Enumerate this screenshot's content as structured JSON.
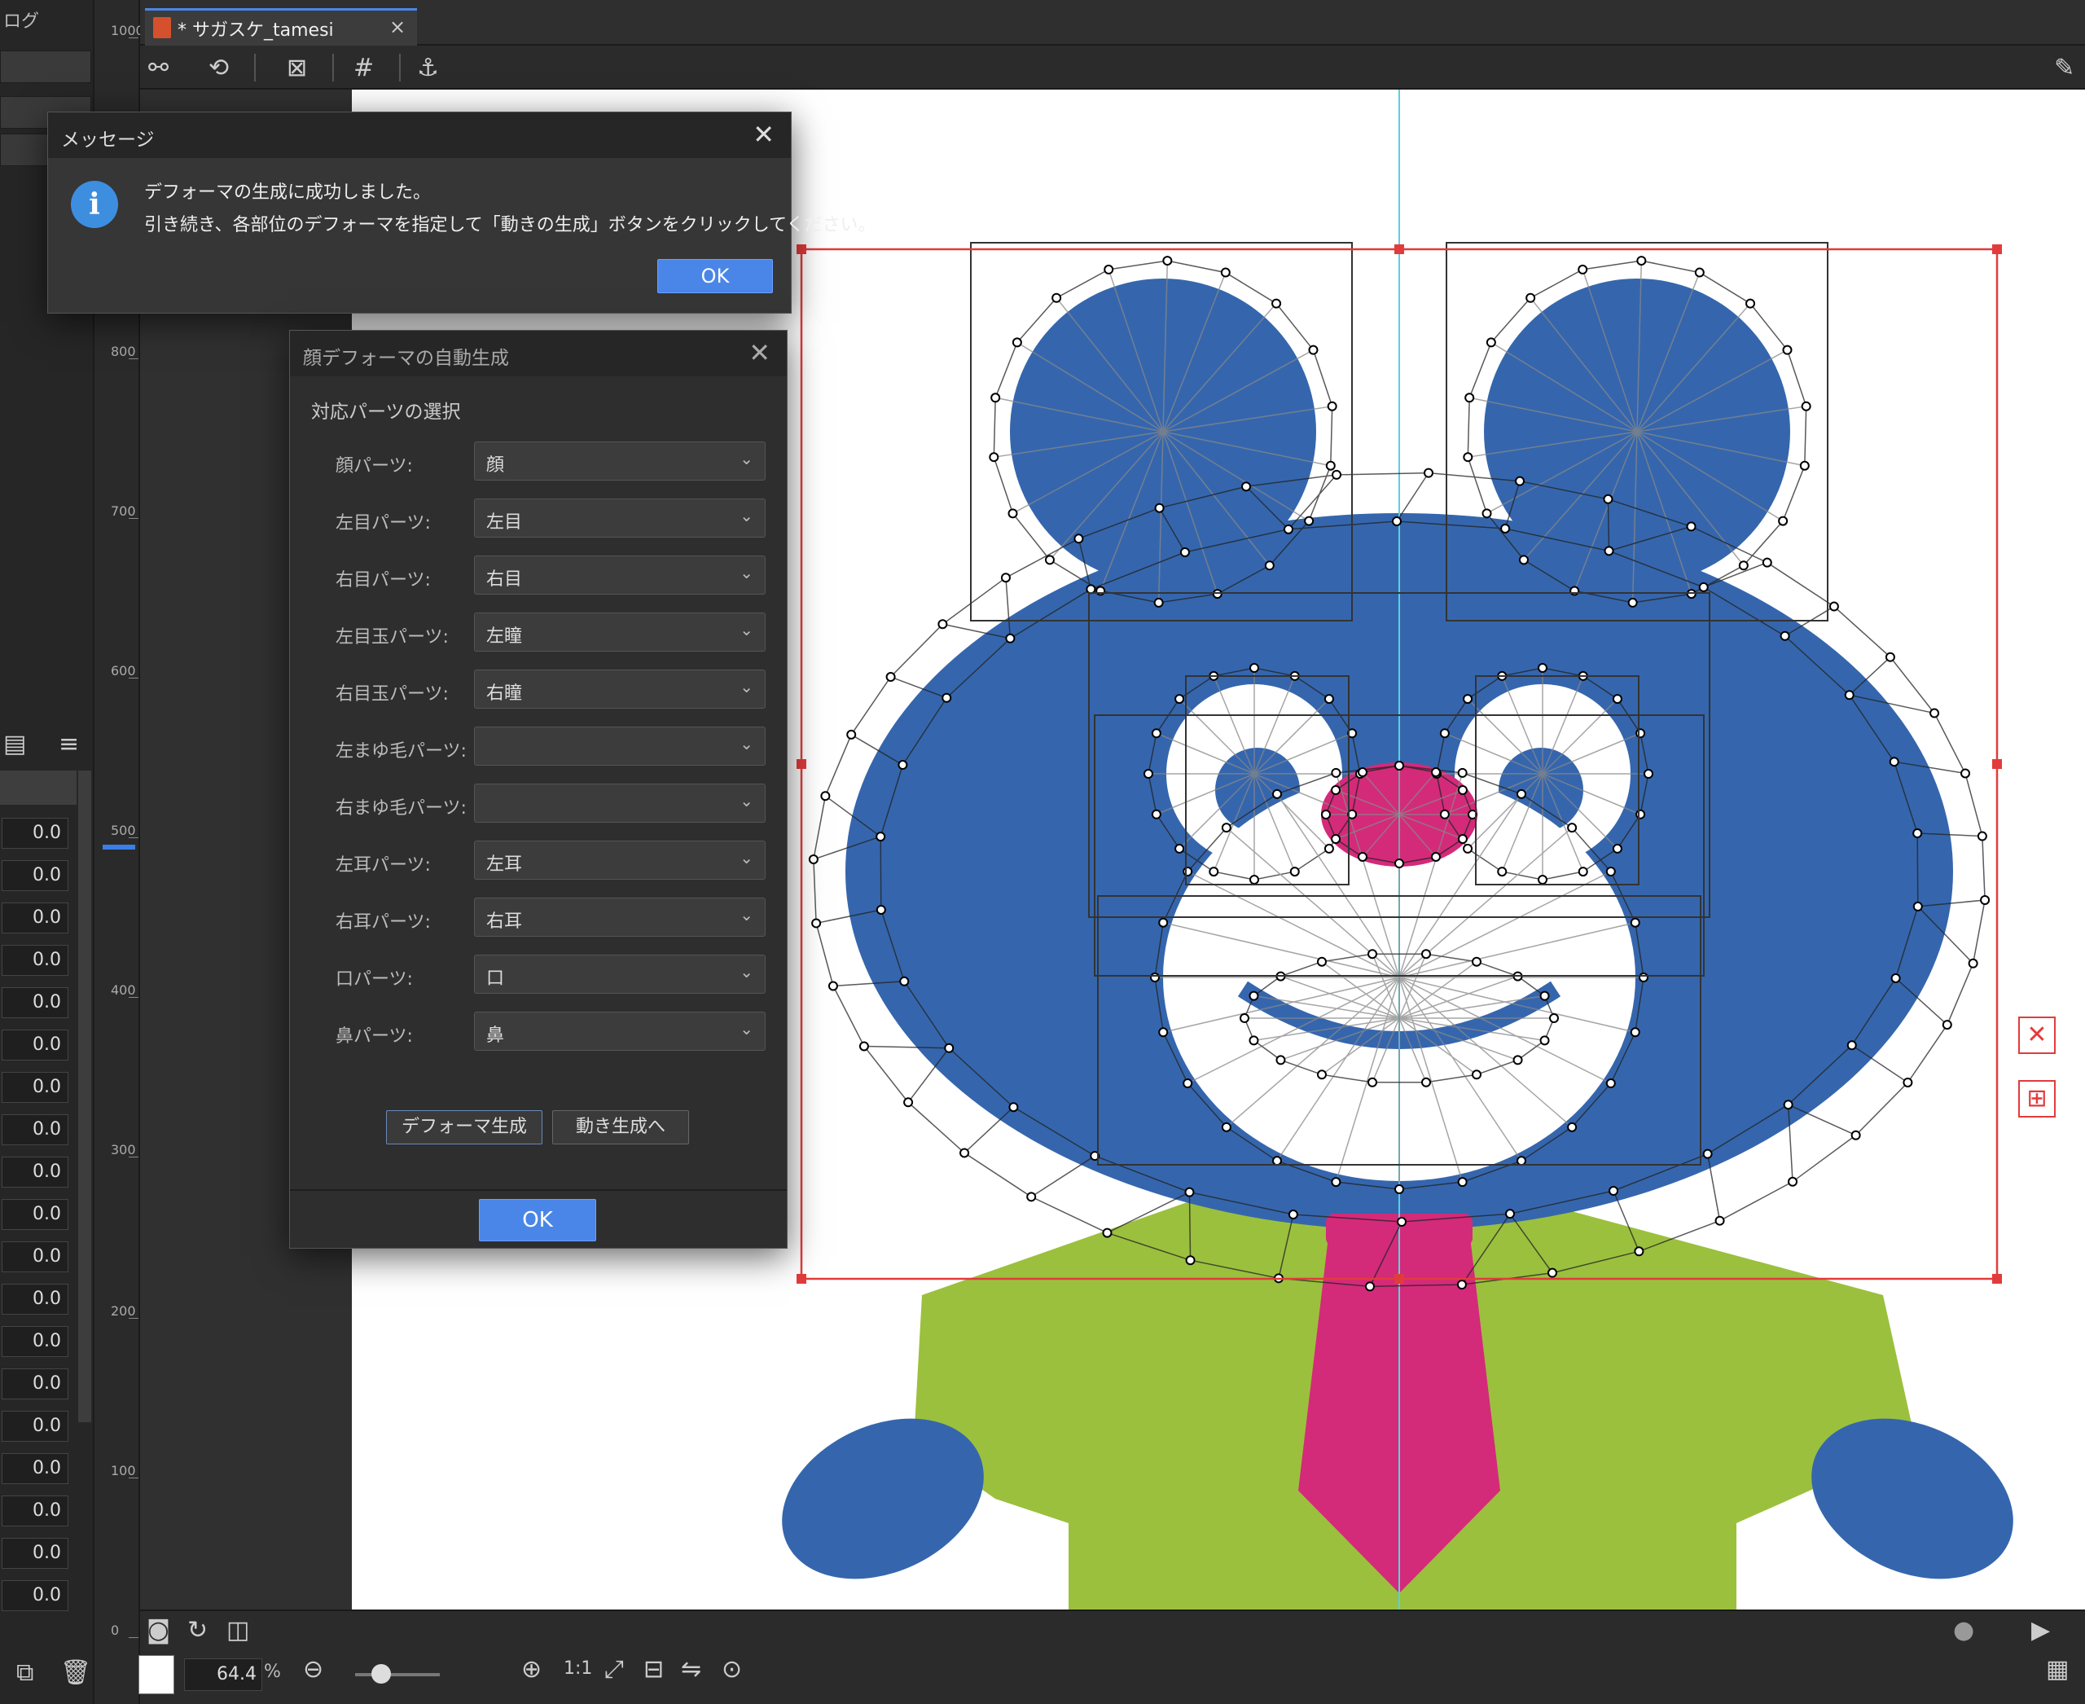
{
  "left_panel": {
    "title": "ログ",
    "values": [
      "0.0",
      "0.0",
      "0.0",
      "0.0",
      "0.0",
      "0.0",
      "0.0",
      "0.0",
      "0.0",
      "0.0",
      "0.0",
      "0.0",
      "0.0",
      "0.0",
      "0.0",
      "0.0",
      "0.0",
      "0.0",
      "0.0"
    ]
  },
  "ruler": {
    "ticks": [
      "1000",
      "800",
      "700",
      "600",
      "500",
      "400",
      "300",
      "200",
      "100",
      "0"
    ]
  },
  "tab": {
    "title": "* サガスケ_tamesi",
    "close": "×"
  },
  "zoom": {
    "value": "64.4",
    "unit": "%",
    "ratio": "1:1"
  },
  "message_dialog": {
    "title": "メッセージ",
    "close": "✕",
    "line1": "デフォーマの生成に成功しました。",
    "line2": "引き続き、各部位のデフォーマを指定して「動きの生成」ボタンをクリックしてください。",
    "ok": "OK"
  },
  "face_dialog": {
    "title": "顔デフォーマの自動生成",
    "close": "✕",
    "section": "対応パーツの選択",
    "rows": [
      {
        "label": "顔パーツ:",
        "value": "顔"
      },
      {
        "label": "左目パーツ:",
        "value": "左目"
      },
      {
        "label": "右目パーツ:",
        "value": "右目"
      },
      {
        "label": "左目玉パーツ:",
        "value": "左瞳"
      },
      {
        "label": "右目玉パーツ:",
        "value": "右瞳"
      },
      {
        "label": "左まゆ毛パーツ:",
        "value": ""
      },
      {
        "label": "右まゆ毛パーツ:",
        "value": ""
      },
      {
        "label": "左耳パーツ:",
        "value": "左耳"
      },
      {
        "label": "右耳パーツ:",
        "value": "右耳"
      },
      {
        "label": "口パーツ:",
        "value": "口"
      },
      {
        "label": "鼻パーツ:",
        "value": "鼻"
      }
    ],
    "generate": "デフォーマ生成",
    "to_motion": "動き生成へ",
    "ok": "OK"
  },
  "colors": {
    "accent": "#4a86e8",
    "bear_blue": "#3566ad",
    "shirt_green": "#9bc03e",
    "tie_pink": "#d42a7a",
    "bbox_red": "#e23b3b"
  },
  "icons": [
    "camera-icon",
    "info-icon",
    "close-icon",
    "chevron-down-icon",
    "zoom-in-icon",
    "zoom-out-icon",
    "play-icon",
    "trash-icon"
  ]
}
